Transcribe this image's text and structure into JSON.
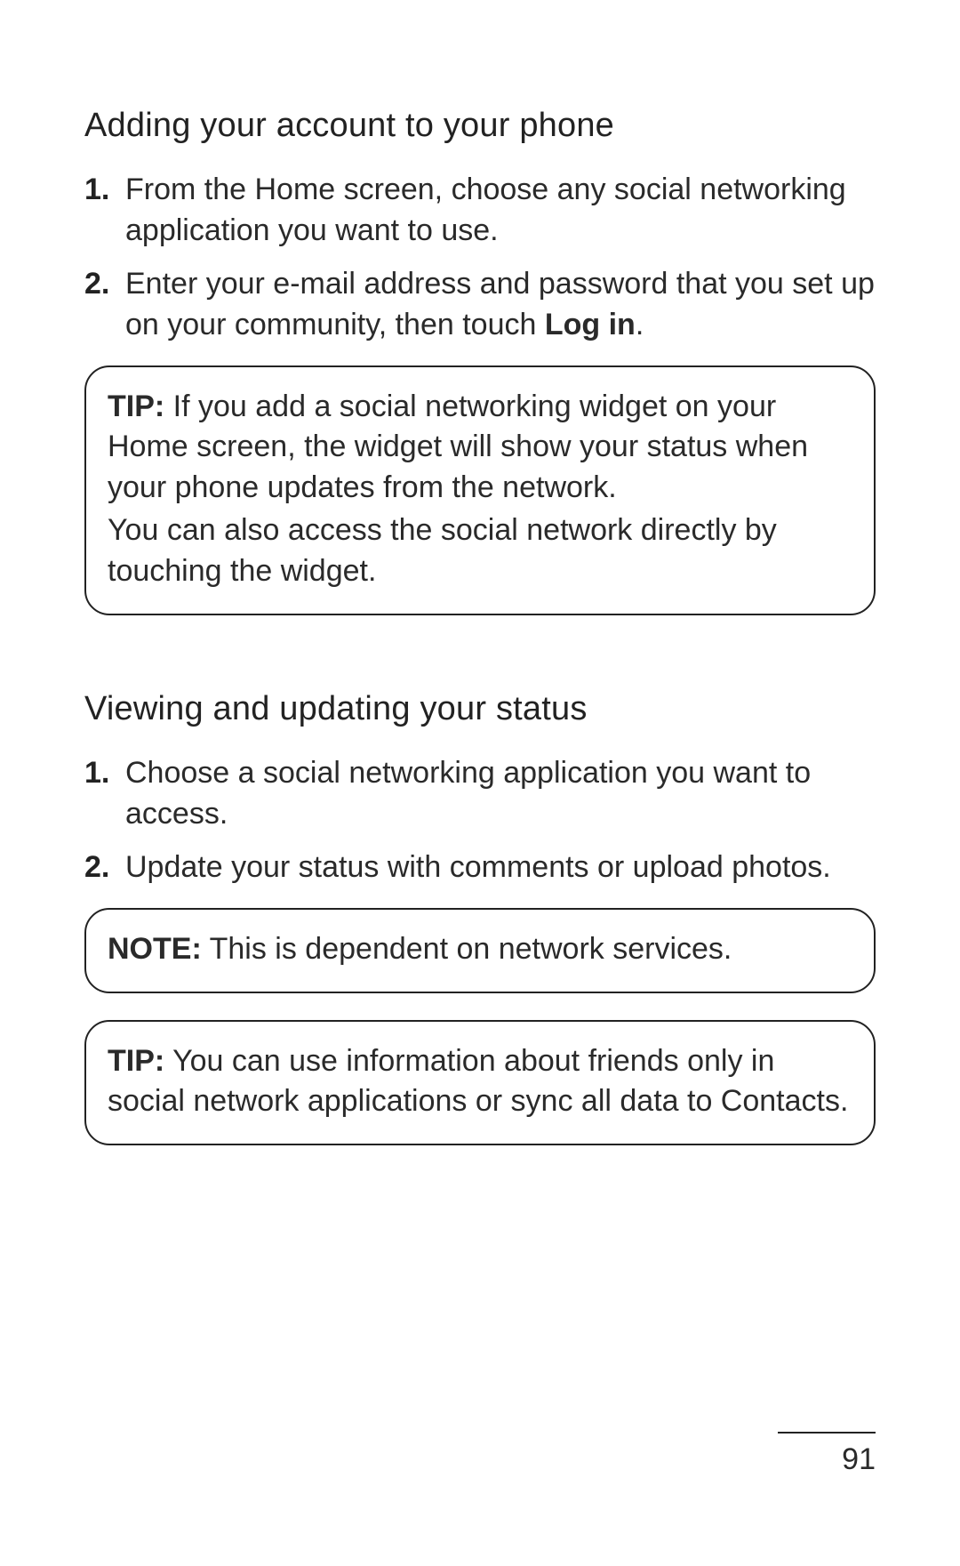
{
  "sections": [
    {
      "heading": "Adding your account to your phone",
      "steps": [
        {
          "text": "From the Home screen, choose any social networking application you want to use."
        },
        {
          "text_pre": "Enter your e-mail address and password that you set up on your community, then touch ",
          "bold": "Log in",
          "text_post": "."
        }
      ],
      "callouts": [
        {
          "label": "TIP:",
          "paragraphs": [
            "If you add a social networking widget on your Home screen, the widget will show your status when your phone updates from the network.",
            "You can also access the social network directly by touching the widget."
          ]
        }
      ]
    },
    {
      "heading": "Viewing and updating your status",
      "steps": [
        {
          "text": "Choose a social networking application you want to access."
        },
        {
          "text": "Update your status with comments or upload photos."
        }
      ],
      "callouts": [
        {
          "label": "NOTE:",
          "paragraphs": [
            "This is dependent on network services."
          ]
        },
        {
          "label": "TIP:",
          "paragraphs": [
            "You can use information about friends only in social network applications or sync all data to Contacts."
          ]
        }
      ]
    }
  ],
  "page_number": "91"
}
